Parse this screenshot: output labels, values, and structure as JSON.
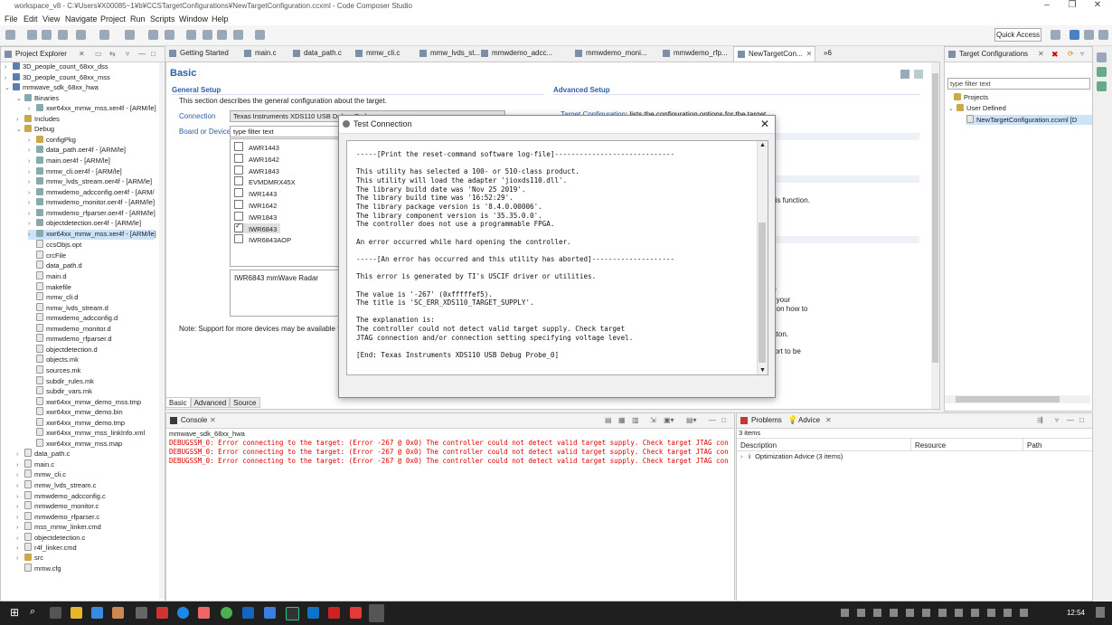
{
  "window": {
    "title": "workspace_v8 - C:¥Users¥X00085~1¥b¥CCSTargetConfigurations¥NewTargetConfiguration.ccxml - Code Composer Studio"
  },
  "menu": [
    "File",
    "Edit",
    "View",
    "Navigate",
    "Project",
    "Run",
    "Scripts",
    "Window",
    "Help"
  ],
  "toolbar": {
    "quick_access": "Quick Access"
  },
  "project_explorer": {
    "title": "Project Explorer",
    "items": [
      {
        "label": "3D_people_count_68xx_dss",
        "indent": 0,
        "kind": "proj",
        "arrow": "›"
      },
      {
        "label": "3D_people_count_68xx_mss",
        "indent": 0,
        "kind": "proj",
        "arrow": "›"
      },
      {
        "label": "mmwave_sdk_68xx_hwa",
        "indent": 0,
        "kind": "proj",
        "arrow": "⌄"
      },
      {
        "label": "Binaries",
        "indent": 1,
        "kind": "bin",
        "arrow": "⌄"
      },
      {
        "label": "xwr64xx_mmw_mss.xer4f - [ARM/le]",
        "indent": 2,
        "kind": "bin",
        "arrow": "›"
      },
      {
        "label": "Includes",
        "indent": 1,
        "kind": "folder",
        "arrow": "›"
      },
      {
        "label": "Debug",
        "indent": 1,
        "kind": "folder",
        "arrow": "⌄"
      },
      {
        "label": "configPkg",
        "indent": 2,
        "kind": "folder",
        "arrow": "›"
      },
      {
        "label": "data_path.oer4f - [ARM/le]",
        "indent": 2,
        "kind": "bin",
        "arrow": "›"
      },
      {
        "label": "main.oer4f - [ARM/le]",
        "indent": 2,
        "kind": "bin",
        "arrow": "›"
      },
      {
        "label": "mmw_cli.oer4f - [ARM/le]",
        "indent": 2,
        "kind": "bin",
        "arrow": "›"
      },
      {
        "label": "mmw_lvds_stream.oer4f - [ARM/le]",
        "indent": 2,
        "kind": "bin",
        "arrow": "›"
      },
      {
        "label": "mmwdemo_adcconfig.oer4f - [ARM/",
        "indent": 2,
        "kind": "bin",
        "arrow": "›"
      },
      {
        "label": "mmwdemo_monitor.oer4f - [ARM/le]",
        "indent": 2,
        "kind": "bin",
        "arrow": "›"
      },
      {
        "label": "mmwdemo_rfparser.oer4f - [ARM/le]",
        "indent": 2,
        "kind": "bin",
        "arrow": "›"
      },
      {
        "label": "objectdetection.oer4f - [ARM/le]",
        "indent": 2,
        "kind": "bin",
        "arrow": "›"
      },
      {
        "label": "xwr64xx_mmw_mss.xer4f - [ARM/le]",
        "indent": 2,
        "kind": "bin",
        "arrow": "›",
        "selected": true
      },
      {
        "label": "ccsObjs.opt",
        "indent": 2,
        "kind": "file",
        "arrow": ""
      },
      {
        "label": "crcFile",
        "indent": 2,
        "kind": "file",
        "arrow": ""
      },
      {
        "label": "data_path.d",
        "indent": 2,
        "kind": "file",
        "arrow": ""
      },
      {
        "label": "main.d",
        "indent": 2,
        "kind": "file",
        "arrow": ""
      },
      {
        "label": "makefile",
        "indent": 2,
        "kind": "file",
        "arrow": ""
      },
      {
        "label": "mmw_cli.d",
        "indent": 2,
        "kind": "file",
        "arrow": ""
      },
      {
        "label": "mmw_lvds_stream.d",
        "indent": 2,
        "kind": "file",
        "arrow": ""
      },
      {
        "label": "mmwdemo_adcconfig.d",
        "indent": 2,
        "kind": "file",
        "arrow": ""
      },
      {
        "label": "mmwdemo_monitor.d",
        "indent": 2,
        "kind": "file",
        "arrow": ""
      },
      {
        "label": "mmwdemo_rfparser.d",
        "indent": 2,
        "kind": "file",
        "arrow": ""
      },
      {
        "label": "objectdetection.d",
        "indent": 2,
        "kind": "file",
        "arrow": ""
      },
      {
        "label": "objects.mk",
        "indent": 2,
        "kind": "file",
        "arrow": ""
      },
      {
        "label": "sources.mk",
        "indent": 2,
        "kind": "file",
        "arrow": ""
      },
      {
        "label": "subdir_rules.mk",
        "indent": 2,
        "kind": "file",
        "arrow": ""
      },
      {
        "label": "subdir_vars.mk",
        "indent": 2,
        "kind": "file",
        "arrow": ""
      },
      {
        "label": "xwr64xx_mmw_demo_mss.tmp",
        "indent": 2,
        "kind": "file",
        "arrow": ""
      },
      {
        "label": "xwr64xx_mmw_demo.bin",
        "indent": 2,
        "kind": "file",
        "arrow": ""
      },
      {
        "label": "xwr64xx_mmw_demo.tmp",
        "indent": 2,
        "kind": "file",
        "arrow": ""
      },
      {
        "label": "xwr64xx_mmw_mss_linkInfo.xml",
        "indent": 2,
        "kind": "file",
        "arrow": ""
      },
      {
        "label": "xwr64xx_mmw_mss.map",
        "indent": 2,
        "kind": "file",
        "arrow": ""
      },
      {
        "label": "data_path.c",
        "indent": 1,
        "kind": "file",
        "arrow": "›"
      },
      {
        "label": "main.c",
        "indent": 1,
        "kind": "file",
        "arrow": "›"
      },
      {
        "label": "mmw_cli.c",
        "indent": 1,
        "kind": "file",
        "arrow": "›"
      },
      {
        "label": "mmw_lvds_stream.c",
        "indent": 1,
        "kind": "file",
        "arrow": "›"
      },
      {
        "label": "mmwdemo_adcconfig.c",
        "indent": 1,
        "kind": "file",
        "arrow": "›"
      },
      {
        "label": "mmwdemo_monitor.c",
        "indent": 1,
        "kind": "file",
        "arrow": "›"
      },
      {
        "label": "mmwdemo_rfparser.c",
        "indent": 1,
        "kind": "file",
        "arrow": "›"
      },
      {
        "label": "mss_mmw_linker.cmd",
        "indent": 1,
        "kind": "file",
        "arrow": "›"
      },
      {
        "label": "objectdetection.c",
        "indent": 1,
        "kind": "file",
        "arrow": "›"
      },
      {
        "label": "r4f_linker.cmd",
        "indent": 1,
        "kind": "file",
        "arrow": "›"
      },
      {
        "label": "src",
        "indent": 1,
        "kind": "folder",
        "arrow": "›"
      },
      {
        "label": "mmw.cfg",
        "indent": 1,
        "kind": "file",
        "arrow": ""
      }
    ]
  },
  "editor_tabs": [
    "Getting Started",
    "main.c",
    "data_path.c",
    "mmw_cli.c",
    "mmw_lvds_st...",
    "mmwdemo_adcc...",
    "mmwdemo_moni...",
    "mmwdemo_rfp...",
    "NewTargetCon..."
  ],
  "editor_tabs_overflow": "»6",
  "editor": {
    "heading": "Basic",
    "general_setup": "General Setup",
    "general_desc": "This section describes the general configuration about the target.",
    "connection_label": "Connection",
    "connection_value": "Texas Instruments XDS110 USB Debug Probe",
    "board_label": "Board or Device",
    "filter_placeholder": "type filter text",
    "devices": [
      {
        "name": "AWR1443",
        "checked": false
      },
      {
        "name": "AWR1642",
        "checked": false
      },
      {
        "name": "AWR1843",
        "checked": false
      },
      {
        "name": "EVMDMRX45X",
        "checked": false
      },
      {
        "name": "IWR1443",
        "checked": false
      },
      {
        "name": "IWR1642",
        "checked": false
      },
      {
        "name": "IWR1843",
        "checked": false
      },
      {
        "name": "IWR6843",
        "checked": true
      },
      {
        "name": "IWR6843AOP",
        "checked": false
      }
    ],
    "device_desc": "IWR6843 mmWave Radar",
    "note": "Note: Support for more devices may be available fro",
    "advanced_setup": "Advanced Setup",
    "target_config_link": "Target Configuration",
    "target_config_text": ": lists the configuration options for the target.",
    "frag1": "this function.",
    "frag2": "or",
    "frag3": "If your",
    "frag4": "n on how to",
    "frag5": "utton.",
    "frag6": "port to be",
    "bottom_tabs": [
      "Basic",
      "Advanced",
      "Source"
    ]
  },
  "target_configs": {
    "title": "Target Configurations",
    "filter_placeholder": "type filter text",
    "projects": "Projects",
    "user_defined": "User Defined",
    "file": "NewTargetConfiguration.ccxml [D"
  },
  "console": {
    "title": "Console",
    "subtitle": "mmwave_sdk_68xx_hwa",
    "lines": [
      "DEBUGSSM_0: Error connecting to the target: (Error -267 @ 0x0) The controller could not detect valid target supply. Check target JTAG con",
      "DEBUGSSM_0: Error connecting to the target: (Error -267 @ 0x0) The controller could not detect valid target supply. Check target JTAG con",
      "DEBUGSSM_0: Error connecting to the target: (Error -267 @ 0x0) The controller could not detect valid target supply. Check target JTAG con"
    ]
  },
  "problems": {
    "tab1": "Problems",
    "tab2": "Advice",
    "count": "3 items",
    "col_desc": "Description",
    "col_resource": "Resource",
    "col_path": "Path",
    "row": "Optimization Advice (3 items)"
  },
  "dialog": {
    "title": "Test Connection",
    "log": "-----[Print the reset-command software log-file]-----------------------------\n\nThis utility has selected a 100- or 510-class product.\nThis utility will load the adapter 'jioxds110.dll'.\nThe library build date was 'Nov 25 2019'.\nThe library build time was '16:52:29'.\nThe library package version is '8.4.0.00006'.\nThe library component version is '35.35.0.0'.\nThe controller does not use a programmable FPGA.\n\nAn error occurred while hard opening the controller.\n\n-----[An error has occurred and this utility has aborted]--------------------\n\nThis error is generated by TI's USCIF driver or utilities.\n\nThe value is '-267' (0xfffffef5).\nThe title is 'SC_ERR_XDS110_TARGET_SUPPLY'.\n\nThe explanation is:\nThe controller could not detect valid target supply. Check target\nJTAG connection and/or connection setting specifying voltage level.\n\n[End: Texas Instruments XDS110 USB Debug Probe_0]"
  },
  "taskbar": {
    "time": "12:54"
  },
  "colors": {
    "accent": "#2b5fa8",
    "error": "#dd0000",
    "taskbar": "#1f1f1f"
  }
}
